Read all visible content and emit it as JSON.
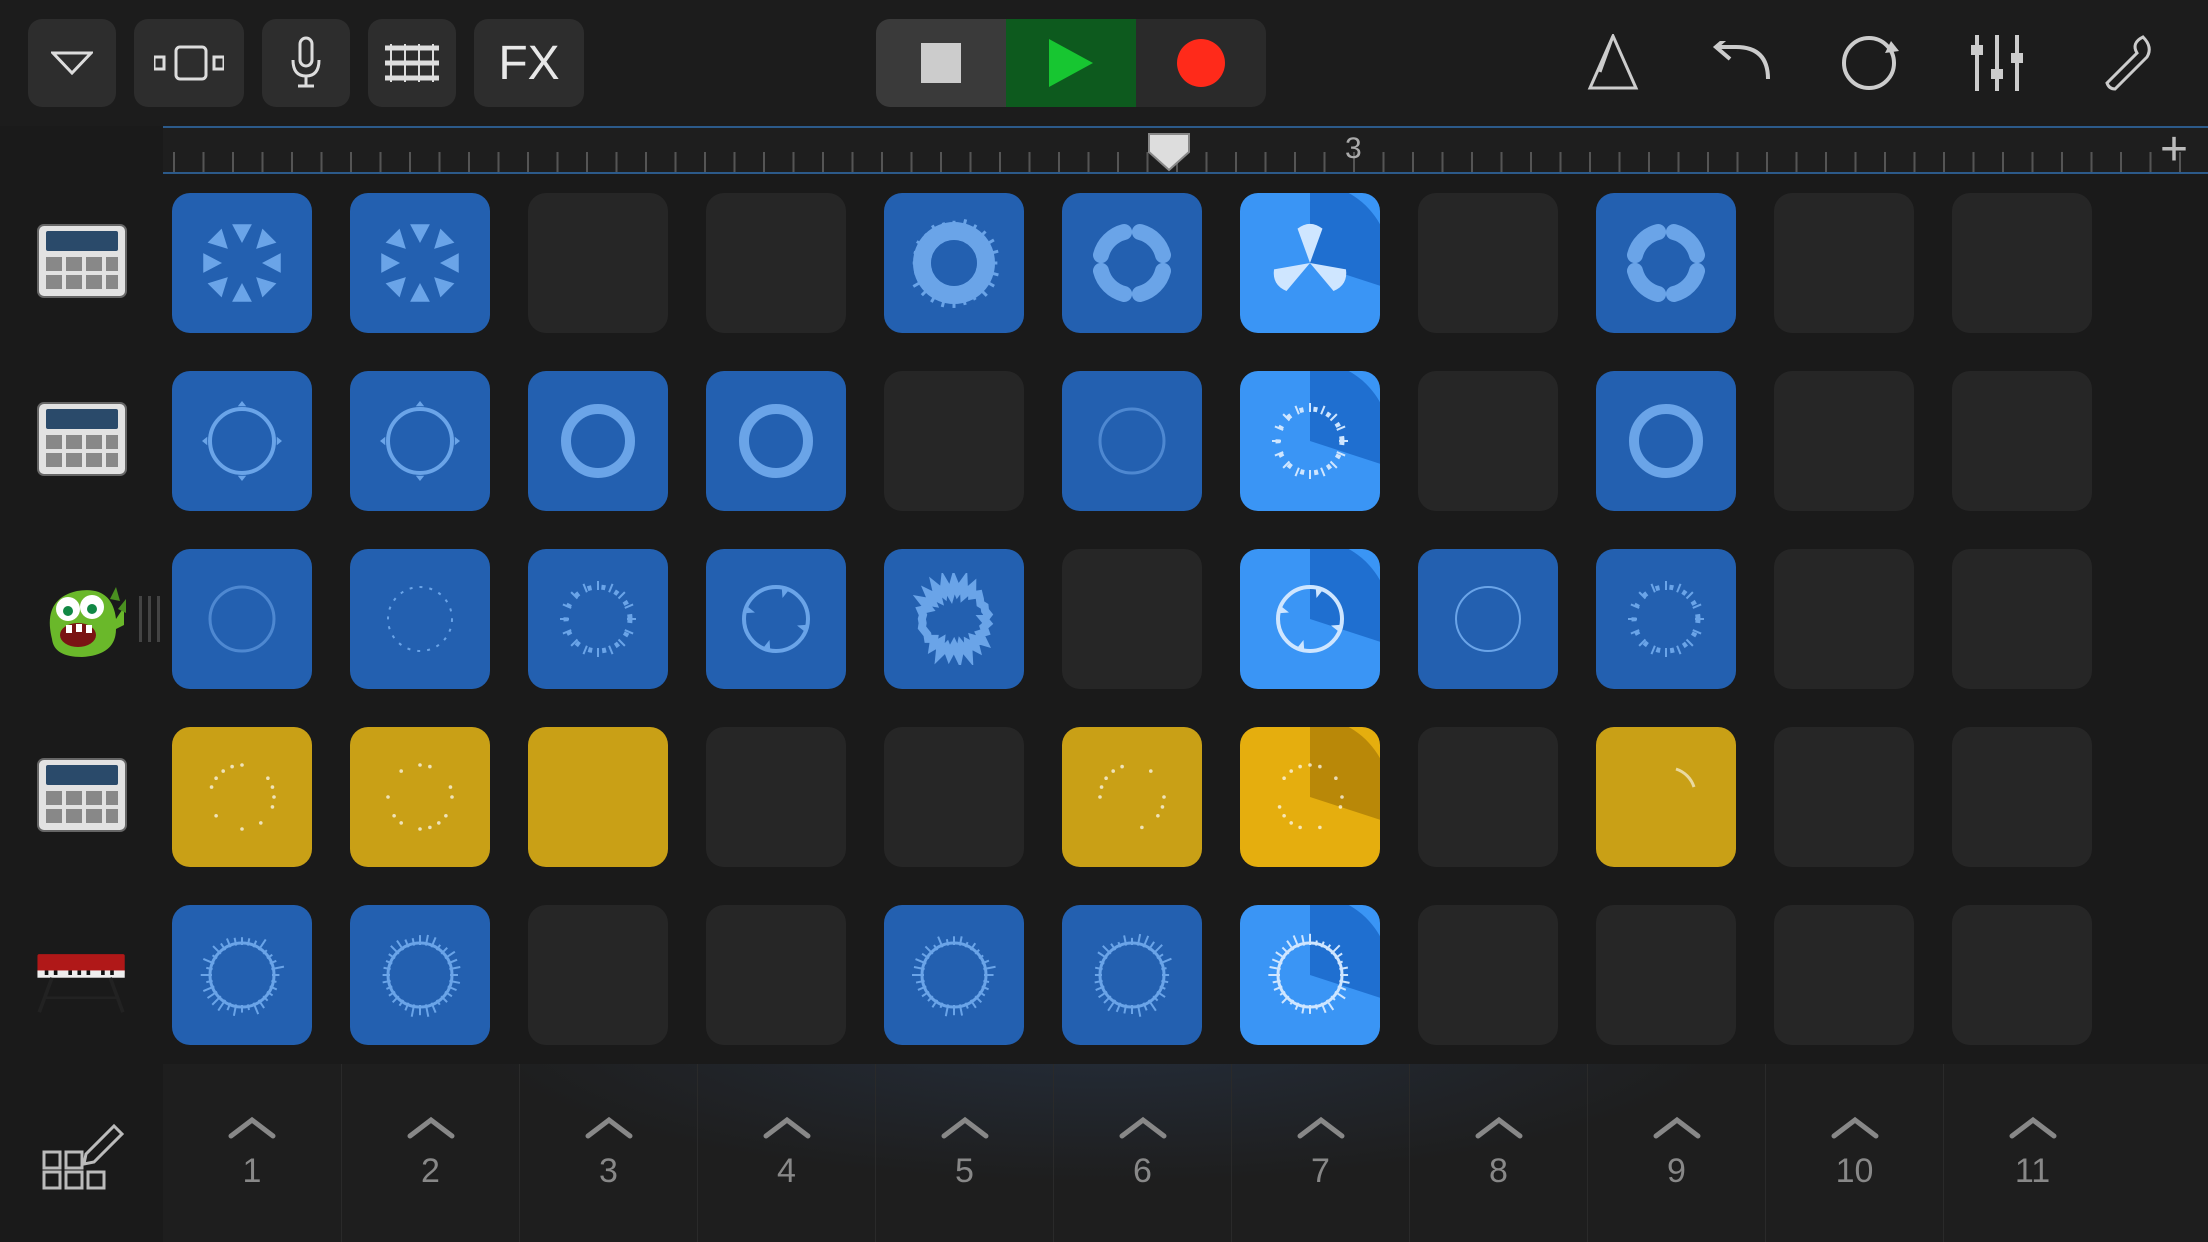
{
  "toolbar": {
    "fx_label": "FX"
  },
  "ruler": {
    "playhead_position_pct": 49.2,
    "marker_number": "3",
    "marker_position_pct": 57.8
  },
  "tracks": [
    {
      "icon": "drum-machine"
    },
    {
      "icon": "drum-machine"
    },
    {
      "icon": "monster"
    },
    {
      "icon": "drum-machine"
    },
    {
      "icon": "keyboard"
    }
  ],
  "grid": {
    "columns": 11,
    "rows": [
      [
        {
          "filled": true,
          "kind": "blue",
          "wave": "burst"
        },
        {
          "filled": true,
          "kind": "blue",
          "wave": "burst"
        },
        {
          "filled": false
        },
        {
          "filled": false
        },
        {
          "filled": true,
          "kind": "blue",
          "wave": "ring-thick"
        },
        {
          "filled": true,
          "kind": "blue",
          "wave": "seg4"
        },
        {
          "filled": true,
          "kind": "bright",
          "wave": "fan",
          "progress": 30
        },
        {
          "filled": false
        },
        {
          "filled": true,
          "kind": "blue",
          "wave": "seg4"
        },
        {
          "filled": false
        },
        {
          "filled": false
        }
      ],
      [
        {
          "filled": true,
          "kind": "blue",
          "wave": "ring-dot"
        },
        {
          "filled": true,
          "kind": "blue",
          "wave": "ring-dot"
        },
        {
          "filled": true,
          "kind": "blue",
          "wave": "ring"
        },
        {
          "filled": true,
          "kind": "blue",
          "wave": "ring"
        },
        {
          "filled": false
        },
        {
          "filled": true,
          "kind": "blue",
          "wave": "ring-faint"
        },
        {
          "filled": true,
          "kind": "bright",
          "wave": "ring-dash",
          "progress": 30
        },
        {
          "filled": false
        },
        {
          "filled": true,
          "kind": "blue",
          "wave": "ring"
        },
        {
          "filled": false
        },
        {
          "filled": false
        }
      ],
      [
        {
          "filled": true,
          "kind": "blue",
          "wave": "ring-faint"
        },
        {
          "filled": true,
          "kind": "blue",
          "wave": "ring-tiny"
        },
        {
          "filled": true,
          "kind": "blue",
          "wave": "ring-dash"
        },
        {
          "filled": true,
          "kind": "blue",
          "wave": "ring-arrow"
        },
        {
          "filled": true,
          "kind": "blue",
          "wave": "ring-rough"
        },
        {
          "filled": false
        },
        {
          "filled": true,
          "kind": "bright",
          "wave": "ring-arrow",
          "progress": 30
        },
        {
          "filled": true,
          "kind": "blue",
          "wave": "ring-thin"
        },
        {
          "filled": true,
          "kind": "blue",
          "wave": "ring-dash"
        },
        {
          "filled": false
        },
        {
          "filled": false
        }
      ],
      [
        {
          "filled": true,
          "kind": "yellow",
          "wave": "dots"
        },
        {
          "filled": true,
          "kind": "yellow",
          "wave": "dots"
        },
        {
          "filled": true,
          "kind": "yellow",
          "wave": "none"
        },
        {
          "filled": false
        },
        {
          "filled": false
        },
        {
          "filled": true,
          "kind": "yellow",
          "wave": "dots"
        },
        {
          "filled": true,
          "kind": "yellowb",
          "wave": "dots",
          "progress": 30
        },
        {
          "filled": false
        },
        {
          "filled": true,
          "kind": "yellow",
          "wave": "arc"
        },
        {
          "filled": false
        },
        {
          "filled": false
        }
      ],
      [
        {
          "filled": true,
          "kind": "blue",
          "wave": "ring-spike"
        },
        {
          "filled": true,
          "kind": "blue",
          "wave": "ring-spike"
        },
        {
          "filled": false
        },
        {
          "filled": false
        },
        {
          "filled": true,
          "kind": "blue",
          "wave": "ring-spike"
        },
        {
          "filled": true,
          "kind": "blue",
          "wave": "ring-spike"
        },
        {
          "filled": true,
          "kind": "bright",
          "wave": "ring-spike",
          "progress": 30
        },
        {
          "filled": false
        },
        {
          "filled": false
        },
        {
          "filled": false
        },
        {
          "filled": false
        }
      ]
    ]
  },
  "scenes": [
    "1",
    "2",
    "3",
    "4",
    "5",
    "6",
    "7",
    "8",
    "9",
    "10",
    "11"
  ]
}
